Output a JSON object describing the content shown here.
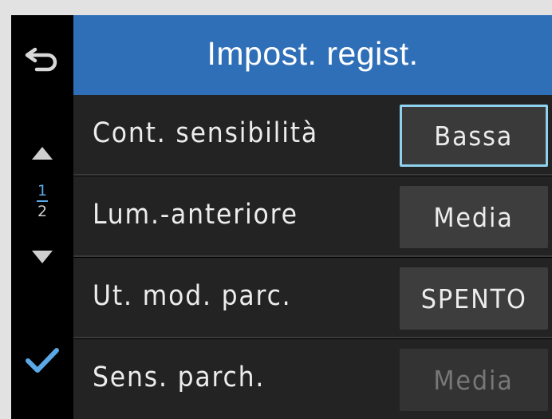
{
  "header": {
    "title": "Impost. regist."
  },
  "sidebar": {
    "page_current": "1",
    "page_total": "2",
    "icons": [
      "back-arrow-icon",
      "up-triangle-icon",
      "down-triangle-icon",
      "checkmark-icon"
    ]
  },
  "settings": [
    {
      "label": "Cont. sensibilità",
      "value": "Bassa",
      "state": "selected"
    },
    {
      "label": "Lum.-anteriore",
      "value": "Media",
      "state": "normal"
    },
    {
      "label": "Ut. mod. parc.",
      "value": "SPENTO",
      "state": "normal"
    },
    {
      "label": "Sens. parch.",
      "value": "Media",
      "state": "disabled"
    }
  ],
  "colors": {
    "header_bg": "#2f6fb8",
    "accent": "#5aa9e6",
    "selected_border": "#8fd2ee",
    "row_bg": "#232323",
    "button_bg": "#3d3d3d"
  }
}
